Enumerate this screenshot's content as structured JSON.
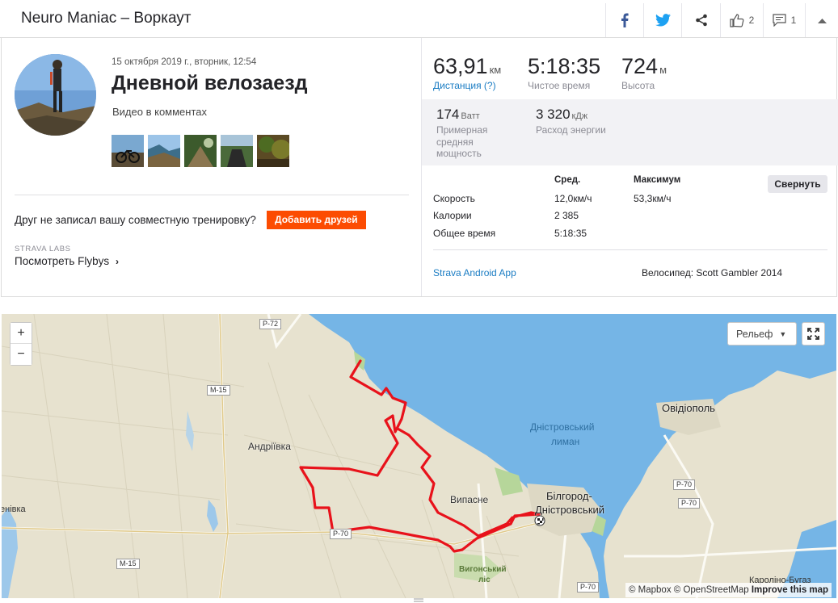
{
  "header": {
    "title": "Neuro Maniac – Воркаут",
    "kudos_count": "2",
    "comments_count": "1"
  },
  "activity": {
    "date": "15 октября 2019 г., вторник, 12:54",
    "title": "Дневной велозаезд",
    "description": "Видео в комментах",
    "photos": [
      "photo-1",
      "photo-2",
      "photo-3",
      "photo-4",
      "photo-5"
    ]
  },
  "friends": {
    "prompt": "Друг не записал вашу совместную тренировку?",
    "add_button": "Добавить друзей"
  },
  "labs": {
    "label": "STRAVA LABS",
    "flyby_link": "Посмотреть Flybys"
  },
  "stats": {
    "distance": {
      "value": "63,91",
      "unit": "км",
      "label": "Дистанция (?)"
    },
    "moving_time": {
      "value": "5:18:35",
      "label": "Чистое время"
    },
    "elevation": {
      "value": "724",
      "unit": "м",
      "label": "Высота"
    },
    "power": {
      "value": "174",
      "unit": "Ватт",
      "label": "Примерная средняя мощность"
    },
    "energy": {
      "value": "3 320",
      "unit": "кДж",
      "label": "Расход энергии"
    }
  },
  "details": {
    "col_avg": "Сред.",
    "col_max": "Максимум",
    "collapse_button": "Свернуть",
    "rows": [
      {
        "label": "Скорость",
        "avg": "12,0км/ч",
        "max": "53,3км/ч"
      },
      {
        "label": "Калории",
        "avg": "2 385",
        "max": ""
      },
      {
        "label": "Общее время",
        "avg": "5:18:35",
        "max": ""
      }
    ],
    "device": "Strava Android App",
    "bike": "Велосипед: Scott Gambler 2014"
  },
  "map": {
    "zoom_in": "+",
    "zoom_out": "−",
    "layer_select": "Рельеф",
    "labels": {
      "p72": "P-72",
      "m15_top": "M-15",
      "m15_bottom": "M-15",
      "p70_a": "P-70",
      "p70_b": "P-70",
      "p70_c": "P-70",
      "p70_route": "P-70",
      "andriivka": "Андріївка",
      "vypasne": "Випасне",
      "bilgorod_1": "Білгород-",
      "bilgorod_2": "Дністровський",
      "ovidiopol": "Овідіополь",
      "liman_1": "Дністровський",
      "liman_2": "лиман",
      "vygonsky_1": "Вигонський",
      "vygonsky_2": "ліс",
      "karolino": "Кароліно-Бугаз",
      "tenivka": "енівка"
    },
    "attribution_mapbox": "© Mapbox",
    "attribution_osm": "© OpenStreetMap",
    "attribution_improve": "Improve this map",
    "colors": {
      "route": "#e8121b",
      "water": "#75b5e6",
      "land": "#e7e2cf",
      "accent": "#fc4c02"
    }
  }
}
